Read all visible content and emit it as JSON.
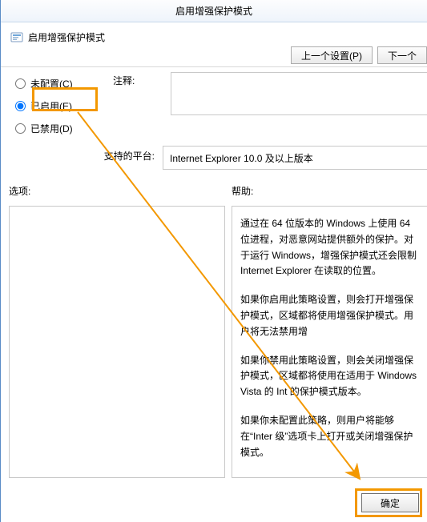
{
  "titlebar": "启用增强保护模式",
  "header": {
    "title": "启用增强保护模式",
    "prev": "上一个设置(P)",
    "next": "下一个"
  },
  "radios": {
    "notconfig": "未配置(C)",
    "enabled": "已启用(E)",
    "disabled": "已禁用(D)"
  },
  "labels": {
    "comments": "注释:",
    "platforms": "支持的平台:",
    "options": "选项:",
    "help": "帮助:"
  },
  "platforms_value": "Internet Explorer 10.0 及以上版本",
  "help_paragraphs": {
    "p1": "通过在 64 位版本的 Windows 上使用 64 位进程，对恶意网站提供额外的保护。对于运行 Windows，增强保护模式还会限制 Internet Explorer 在读取的位置。",
    "p2": "如果你启用此策略设置，则会打开增强保护模式，区域都将使用增强保护模式。用户将无法禁用增",
    "p3": "如果你禁用此策略设置，则会关闭增强保护模式，区域都将使用在适用于 Windows Vista 的 Int 的保护模式版本。",
    "p4": "如果你未配置此策略，则用户将能够在“Inter 级”选项卡上打开或关闭增强保护模式。"
  },
  "buttons": {
    "ok": "确定"
  }
}
